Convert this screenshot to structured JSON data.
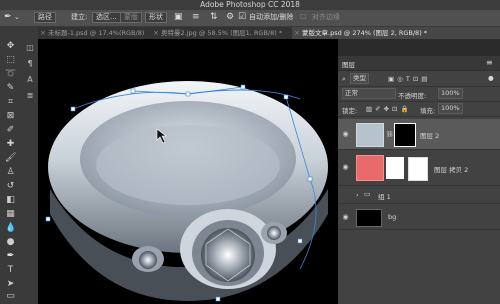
{
  "app": {
    "title": "Adobe Photoshop CC 2018"
  },
  "options_bar": {
    "path_mode": "路径",
    "make_label": "建立:",
    "selection_button": "选区...",
    "mask_button": "蒙版",
    "shape_button": "形状",
    "auto_add_delete": "自动添加/删除",
    "align_edges": "对齐边缘"
  },
  "tabs": [
    {
      "label": "未标题-1.psd @ 17.4%(RGB/8)"
    },
    {
      "label": "奥特曼2.jpg @ 58.5% (图层1, RGB/8) *"
    },
    {
      "label": "蒙版文章.psd @ 274% (图层 2, RGB/8) *"
    }
  ],
  "layers_panel": {
    "title": "图层",
    "filter_kind": "类型",
    "blend_mode": "正常",
    "opacity_label": "不透明度:",
    "opacity_value": "100%",
    "lock_label": "锁定:",
    "fill_label": "填充:",
    "fill_value": "100%",
    "layers": [
      {
        "name": "图层 2"
      },
      {
        "name": "图层 拷贝 2"
      },
      {
        "name": "组 1"
      },
      {
        "name": "bg"
      }
    ]
  },
  "colors": {
    "accent": "#3d84d8",
    "canvas_bg": "#000000",
    "panel_bg": "#424242"
  }
}
